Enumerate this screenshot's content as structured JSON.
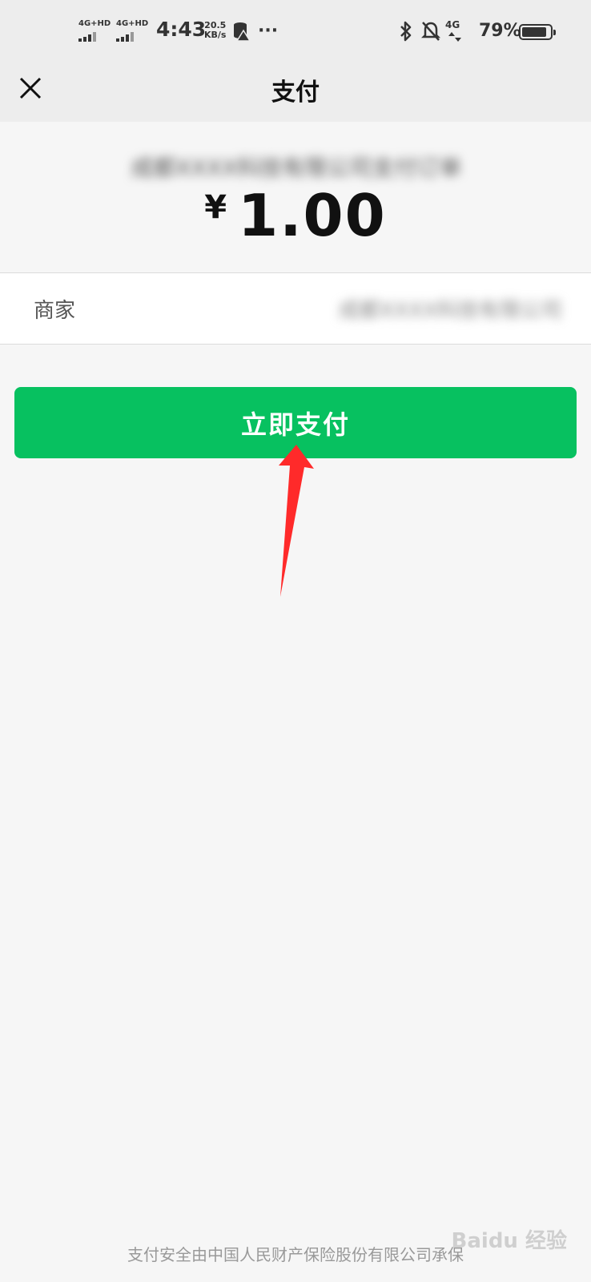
{
  "status_bar": {
    "signal1_label": "4G+HD",
    "signal2_label": "4G+HD",
    "time": "4:43",
    "speed_value": "20.5",
    "speed_unit": "KB/s",
    "more": "···",
    "network_label": "4G",
    "battery_pct": "79%"
  },
  "header": {
    "title": "支付"
  },
  "summary": {
    "merchant_name_blurred": "成都XXXX科技有限公司支付订单",
    "currency": "¥",
    "amount": "1.00"
  },
  "merchant_row": {
    "label": "商家",
    "value_blurred": "成都XXXX科技有限公司"
  },
  "pay_button": {
    "label": "立即支付"
  },
  "footer": {
    "text": "支付安全由中国人民财产保险股份有限公司承保"
  },
  "watermark": {
    "text": "Baidu 经验"
  },
  "colors": {
    "accent": "#07c160",
    "arrow": "#ff2a2a",
    "header_bg": "#ededed",
    "page_bg": "#f6f6f6"
  }
}
